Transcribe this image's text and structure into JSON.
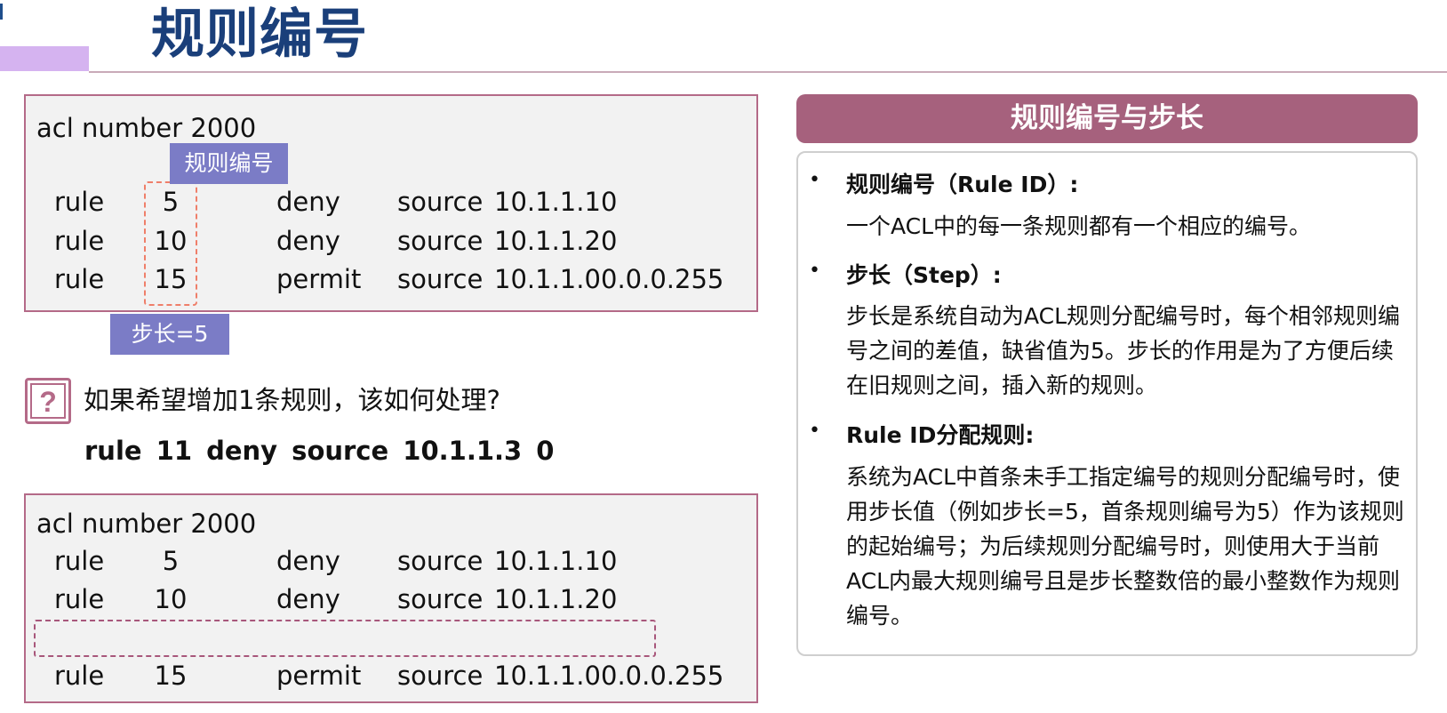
{
  "slide": {
    "title": "规则编号"
  },
  "acl_example_1": {
    "header": "acl number 2000",
    "rows": [
      {
        "keyword": "rule",
        "id": "5",
        "action": "deny",
        "source_kw": "source",
        "ip": "10.1.1.1",
        "wildcard": "0"
      },
      {
        "keyword": "rule",
        "id": "10",
        "action": "deny",
        "source_kw": "source",
        "ip": "10.1.1.2",
        "wildcard": "0"
      },
      {
        "keyword": "rule",
        "id": "15",
        "action": "permit",
        "source_kw": "source",
        "ip": "10.1.1.0",
        "wildcard": "0.0.0.255"
      }
    ],
    "rule_id_label": "规则编号",
    "step_label": "步长=5"
  },
  "question": {
    "text": "如果希望增加1条规则，该如何处理?",
    "answer": "rule 11   deny  source  10.1.1.3  0"
  },
  "acl_example_2": {
    "header": "acl number 2000",
    "rows": [
      {
        "keyword": "rule",
        "id": "5",
        "action": "deny",
        "source_kw": "source",
        "ip": "10.1.1.1",
        "wildcard": "0"
      },
      {
        "keyword": "rule",
        "id": "10",
        "action": "deny",
        "source_kw": "source",
        "ip": "10.1.1.2",
        "wildcard": "0"
      },
      {
        "keyword": "rule",
        "id": "15",
        "action": "permit",
        "source_kw": "source",
        "ip": "10.1.1.0",
        "wildcard": "0.0.0.255"
      }
    ]
  },
  "panel": {
    "title": "规则编号与步长",
    "items": [
      {
        "bullet": "•",
        "heading": "规则编号（Rule ID）:",
        "body": "一个ACL中的每一条规则都有一个相应的编号。"
      },
      {
        "bullet": "•",
        "heading": "步长（Step）:",
        "body": "步长是系统自动为ACL规则分配编号时，每个相邻规则编号之间的差值，缺省值为5。步长的作用是为了方便后续在旧规则之间，插入新的规则。"
      },
      {
        "bullet": "•",
        "heading": "Rule ID分配规则:",
        "body": "系统为ACL中首条未手工指定编号的规则分配编号时，使用步长值（例如步长=5，首条规则编号为5）作为该规则的起始编号；为后续规则分配编号时，则使用大于当前ACL内最大规则编号且是步长整数倍的最小整数作为规则编号。"
      }
    ]
  },
  "colors": {
    "title": "#1a3f7a",
    "accent": "#a6617d",
    "chip": "#7b7cc6",
    "dashed_highlight": "#ef7f6a"
  }
}
